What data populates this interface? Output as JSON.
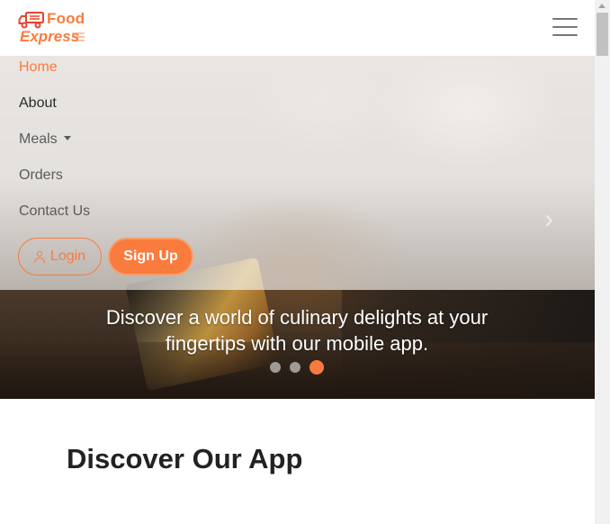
{
  "brand": {
    "line1": "Food",
    "line2": "Express",
    "accent": "#f97b3d"
  },
  "navbar": {
    "toggler_icon": "hamburger-menu-icon",
    "links": [
      {
        "label": "Home",
        "active": true
      },
      {
        "label": "About",
        "active": false
      },
      {
        "label": "Meals",
        "active": false,
        "dropdown": true
      },
      {
        "label": "Orders",
        "active": false
      },
      {
        "label": "Contact Us",
        "active": false
      }
    ],
    "login_label": "Login",
    "login_icon": "user-icon",
    "signup_label": "Sign Up"
  },
  "carousel": {
    "caption": "Discover a world of culinary delights at your fingertips with our mobile app.",
    "slide_count": 3,
    "active_slide": 3,
    "next_icon": "chevron-right-icon"
  },
  "section": {
    "title": "Discover Our App"
  }
}
